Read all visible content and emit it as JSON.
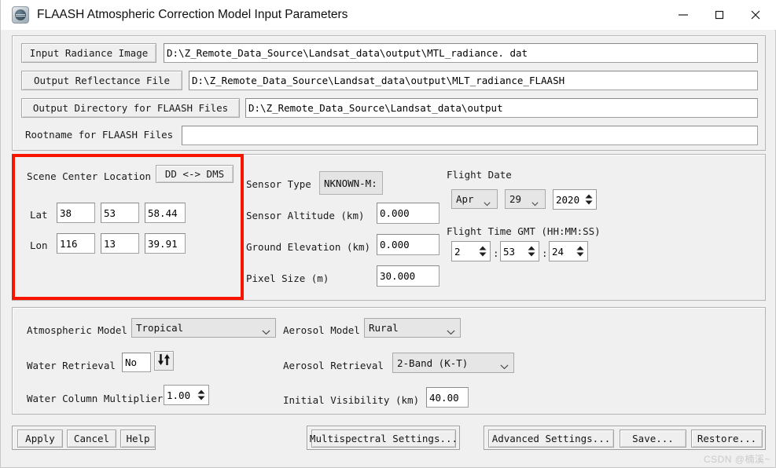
{
  "window": {
    "title": "FLAASH Atmospheric Correction Model Input Parameters",
    "app_icon": "globe-icon",
    "minimize_label": "—",
    "maximize_label": "□",
    "close_label": "✕"
  },
  "files": {
    "input_radiance_label": "Input Radiance Image",
    "input_radiance_value": "D:\\Z_Remote_Data_Source\\Landsat_data\\output\\MTL_radiance. dat",
    "output_reflectance_label": "Output Reflectance File",
    "output_reflectance_value": "D:\\Z_Remote_Data_Source\\Landsat_data\\output\\MLT_radiance_FLAASH",
    "output_directory_label": "Output Directory for FLAASH Files",
    "output_directory_value": "D:\\Z_Remote_Data_Source\\Landsat_data\\output",
    "rootname_label": "Rootname for FLAASH Files",
    "rootname_value": ""
  },
  "scene": {
    "center_location_label": "Scene Center Location",
    "dd_dms_button": "DD <-> DMS",
    "lat_label": "Lat",
    "lat_deg": "38",
    "lat_min": "53",
    "lat_sec": "58.44",
    "lon_label": "Lon",
    "lon_deg": "116",
    "lon_min": "13",
    "lon_sec": "39.91",
    "highlight_color": "#f81500"
  },
  "sensor": {
    "type_label": "Sensor Type",
    "type_value": "NKNOWN-M:",
    "altitude_label": "Sensor Altitude (km)",
    "altitude_value": "0.000",
    "ground_elevation_label": "Ground Elevation (km)",
    "ground_elevation_value": "0.000",
    "pixel_size_label": "Pixel Size (m)",
    "pixel_size_value": "30.000"
  },
  "flight": {
    "date_label": "Flight Date",
    "month": "Apr",
    "day": "29",
    "year": "2020",
    "time_label": "Flight Time GMT (HH:MM:SS)",
    "hour": "2",
    "minute": "53",
    "second": "24",
    "time_sep": ":"
  },
  "atmosphere": {
    "atmospheric_model_label": "Atmospheric Model",
    "atmospheric_model_value": "Tropical",
    "water_retrieval_label": "Water Retrieval",
    "water_retrieval_value": "No",
    "water_retrieval_toggle_icon": "up-down-arrows-icon",
    "water_column_label": "Water Column Multiplier",
    "water_column_value": "1.00",
    "aerosol_model_label": "Aerosol Model",
    "aerosol_model_value": "Rural",
    "aerosol_retrieval_label": "Aerosol Retrieval",
    "aerosol_retrieval_value": "2-Band (K-T)",
    "initial_visibility_label": "Initial Visibility (km)",
    "initial_visibility_value": "40.00"
  },
  "actions": {
    "apply": "Apply",
    "cancel": "Cancel",
    "help": "Help",
    "multispectral_settings": "Multispectral Settings...",
    "advanced_settings": "Advanced Settings...",
    "save": "Save...",
    "restore": "Restore..."
  },
  "watermark": "CSDN @楠溪~"
}
